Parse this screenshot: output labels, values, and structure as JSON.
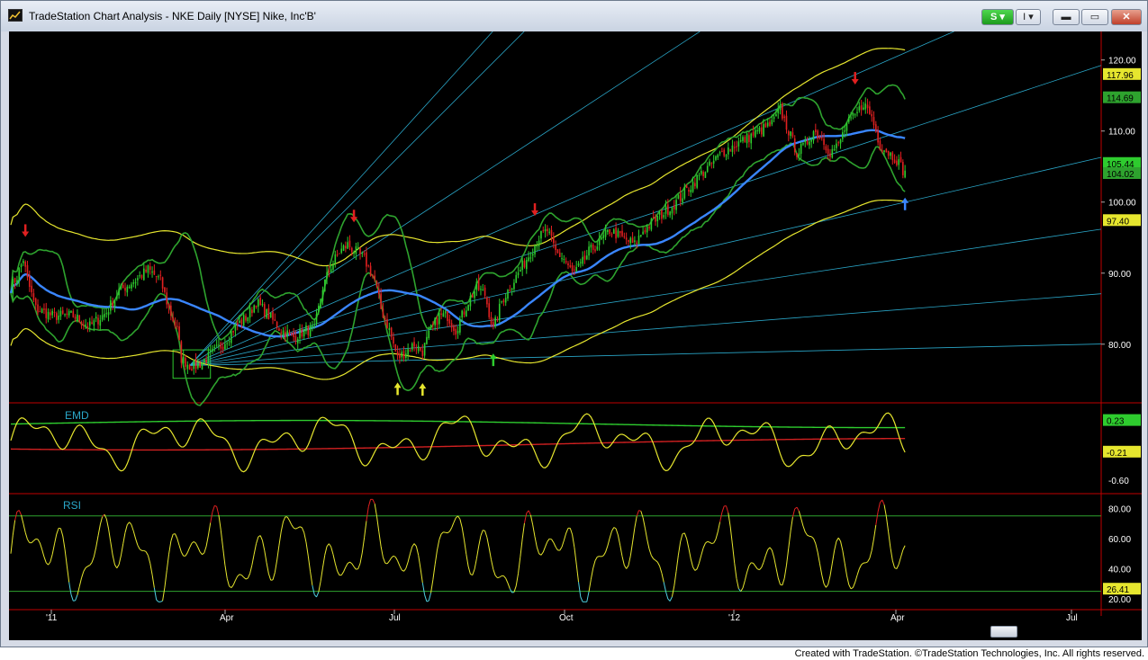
{
  "window": {
    "title": "TradeStation Chart Analysis - NKE Daily [NYSE] Nike, Inc'B'",
    "buttons": {
      "strategy": "S ▾",
      "insert": "I ▾",
      "minimize": "▬",
      "maximize": "▭",
      "close": "✕"
    },
    "app_icon": "chart-icon"
  },
  "footer": "Created with TradeStation. ©TradeStation Technologies, Inc. All rights reserved.",
  "colors": {
    "background": "#000000",
    "up_candle": "#2ecc2e",
    "down_candle": "#e02020",
    "ma": "#3a86ff",
    "bollinger": "#2ea32e",
    "envelope": "#e6e62e",
    "fan": "#2aa7c9",
    "emd_fast": "#e6e62e",
    "emd_green": "#2ecc2e",
    "emd_red": "#d02020",
    "rsi": "#e6e62e",
    "rsi_over": "#e02020",
    "rsi_under": "#4fd0e0",
    "axis": "#c00000"
  },
  "chart_data": [
    {
      "type": "candlestick",
      "panel": "price",
      "x_axis_labels": [
        "'11",
        "Apr",
        "Jul",
        "Oct",
        "'12",
        "Apr",
        "Jul"
      ],
      "y_ticks": [
        "120.00",
        "110.00",
        "100.00",
        "90.00",
        "80.00"
      ],
      "ylim": [
        72,
        123
      ],
      "price_path": [
        [
          0,
          88
        ],
        [
          3,
          89.5
        ],
        [
          6,
          92
        ],
        [
          8,
          89
        ],
        [
          12,
          85
        ],
        [
          20,
          84
        ],
        [
          30,
          84
        ],
        [
          38,
          82.5
        ],
        [
          46,
          84.5
        ],
        [
          52,
          87.5
        ],
        [
          60,
          89
        ],
        [
          66,
          90.5
        ],
        [
          72,
          89
        ],
        [
          76,
          85
        ],
        [
          80,
          82
        ],
        [
          82,
          78
        ],
        [
          86,
          77
        ],
        [
          90,
          77
        ],
        [
          96,
          78.5
        ],
        [
          102,
          80
        ],
        [
          108,
          82.5
        ],
        [
          114,
          84
        ],
        [
          118,
          86
        ],
        [
          124,
          84
        ],
        [
          130,
          82
        ],
        [
          136,
          81
        ],
        [
          142,
          82
        ],
        [
          146,
          82
        ],
        [
          150,
          88
        ],
        [
          154,
          91
        ],
        [
          158,
          93
        ],
        [
          162,
          94
        ],
        [
          166,
          93
        ],
        [
          170,
          92
        ],
        [
          175,
          89
        ],
        [
          178,
          85
        ],
        [
          182,
          82
        ],
        [
          186,
          78
        ],
        [
          190,
          79
        ],
        [
          194,
          80
        ],
        [
          198,
          79
        ],
        [
          202,
          82
        ],
        [
          206,
          84
        ],
        [
          210,
          84
        ],
        [
          214,
          82
        ],
        [
          220,
          86
        ],
        [
          224,
          88
        ],
        [
          228,
          87
        ],
        [
          232,
          82
        ],
        [
          236,
          86
        ],
        [
          240,
          88
        ],
        [
          244,
          90
        ],
        [
          248,
          92
        ],
        [
          254,
          95
        ],
        [
          258,
          96
        ],
        [
          262,
          93
        ],
        [
          266,
          92
        ],
        [
          270,
          90
        ],
        [
          274,
          91
        ],
        [
          278,
          93
        ],
        [
          282,
          94
        ],
        [
          288,
          96
        ],
        [
          294,
          95
        ],
        [
          300,
          94
        ],
        [
          304,
          96
        ],
        [
          308,
          97
        ],
        [
          312,
          98
        ],
        [
          316,
          99
        ],
        [
          320,
          100
        ],
        [
          326,
          102
        ],
        [
          332,
          104
        ],
        [
          336,
          105
        ],
        [
          342,
          107
        ],
        [
          348,
          108
        ],
        [
          354,
          109
        ],
        [
          360,
          110
        ],
        [
          366,
          111
        ],
        [
          370,
          113
        ],
        [
          374,
          110
        ],
        [
          378,
          107
        ],
        [
          382,
          108
        ],
        [
          386,
          110
        ],
        [
          390,
          109
        ],
        [
          394,
          107
        ],
        [
          398,
          108
        ],
        [
          402,
          111
        ],
        [
          406,
          112
        ],
        [
          410,
          114
        ],
        [
          414,
          112
        ],
        [
          418,
          108
        ],
        [
          422,
          107
        ],
        [
          426,
          106
        ],
        [
          430,
          104
        ]
      ],
      "series": [
        {
          "name": "MA",
          "last_value": "105.44"
        },
        {
          "name": "Bollinger Upper",
          "last_value": "114.69"
        },
        {
          "name": "Bollinger Lower",
          "last_value": "104.02"
        },
        {
          "name": "Envelope Upper",
          "last_value": "117.96"
        },
        {
          "name": "Envelope Lower",
          "last_value": "97.40"
        }
      ],
      "markers": [
        {
          "bar": 7,
          "type": "down",
          "color": "#e02020"
        },
        {
          "bar": 165,
          "type": "down",
          "color": "#e02020"
        },
        {
          "bar": 252,
          "type": "down",
          "color": "#e02020"
        },
        {
          "bar": 406,
          "type": "down",
          "color": "#e02020"
        },
        {
          "bar": 186,
          "type": "up",
          "color": "#e6e62e"
        },
        {
          "bar": 198,
          "type": "up",
          "color": "#e6e62e"
        },
        {
          "bar": 232,
          "type": "up",
          "color": "#2ecc2e"
        },
        {
          "bar": 430,
          "type": "up",
          "color": "#3a86ff"
        }
      ]
    },
    {
      "type": "line",
      "panel": "EMD",
      "title": "EMD",
      "y_ticks": [
        "-0.60"
      ],
      "ylim": [
        -0.75,
        0.45
      ],
      "series": [
        {
          "name": "EMD",
          "last_value": "-0.21"
        },
        {
          "name": "Upper",
          "last_value": "0.23"
        },
        {
          "name": "Lower"
        }
      ]
    },
    {
      "type": "line",
      "panel": "RSI",
      "title": "RSI",
      "y_ticks": [
        "80.00",
        "60.00",
        "40.00",
        "20.00"
      ],
      "ylim": [
        14,
        88
      ],
      "overbought": 75,
      "oversold": 25,
      "series": [
        {
          "name": "RSI",
          "last_value": "26.41"
        }
      ]
    }
  ]
}
